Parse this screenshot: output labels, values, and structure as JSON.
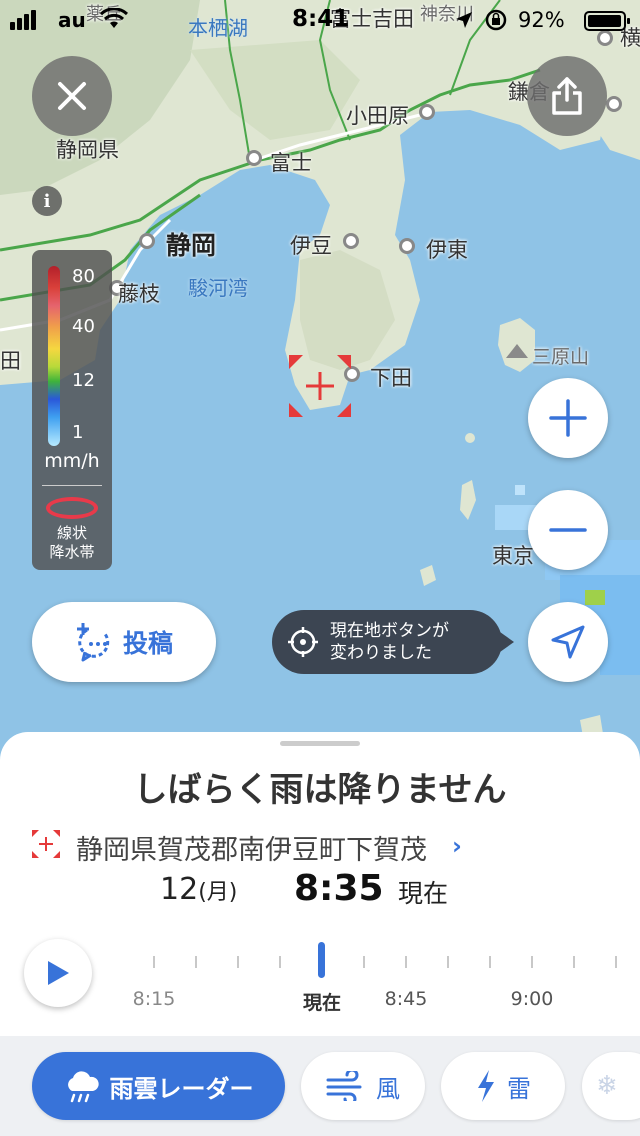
{
  "status_bar": {
    "carrier": "au",
    "time": "8:41",
    "battery": "92%"
  },
  "map": {
    "labels": {
      "shizuoka_pref": "静岡県",
      "shizuoka": "静岡",
      "fujieda": "藤枝",
      "suruga_bay": "駿河湾",
      "fuji": "富士",
      "odawara": "小田原",
      "izu": "伊豆",
      "ito": "伊東",
      "shimoda": "下田",
      "mihara": "三原山",
      "kamakura": "鎌倉",
      "motosu": "本栖湖",
      "fujiyoshida": "富士吉田",
      "tokyo": "東京",
      "hiratsuka_partial": "神奈川",
      "ta_partial": "田",
      "yokohama_partial": "横",
      "top_partial": "薬丘"
    }
  },
  "legend": {
    "ticks": [
      "80",
      "40",
      "12",
      "1"
    ],
    "unit": "mm/h",
    "line_label": "線状\n降水帯"
  },
  "post_button": {
    "label": "投稿"
  },
  "tooltip": {
    "text": "現在地ボタンが\n変わりました"
  },
  "sheet": {
    "headline": "しばらく雨は降りません",
    "address": "静岡県賀茂郡南伊豆町下賀茂",
    "date_day": "12",
    "date_weekday": "(月)",
    "time": "8:35",
    "now_label": "現在",
    "timeline": [
      "8:15",
      "現在",
      "8:45",
      "9:00"
    ]
  },
  "tabs": [
    {
      "label": "雨雲レーダー",
      "icon": "rain-cloud-icon"
    },
    {
      "label": "風",
      "icon": "wind-icon"
    },
    {
      "label": "雷",
      "icon": "lightning-icon"
    },
    {
      "label": "",
      "icon": "snow-icon"
    }
  ],
  "colors": {
    "accent": "#3873d9",
    "sea": "#8fc3e6",
    "land": "#dfe6d2",
    "marker": "#e53a3a"
  }
}
